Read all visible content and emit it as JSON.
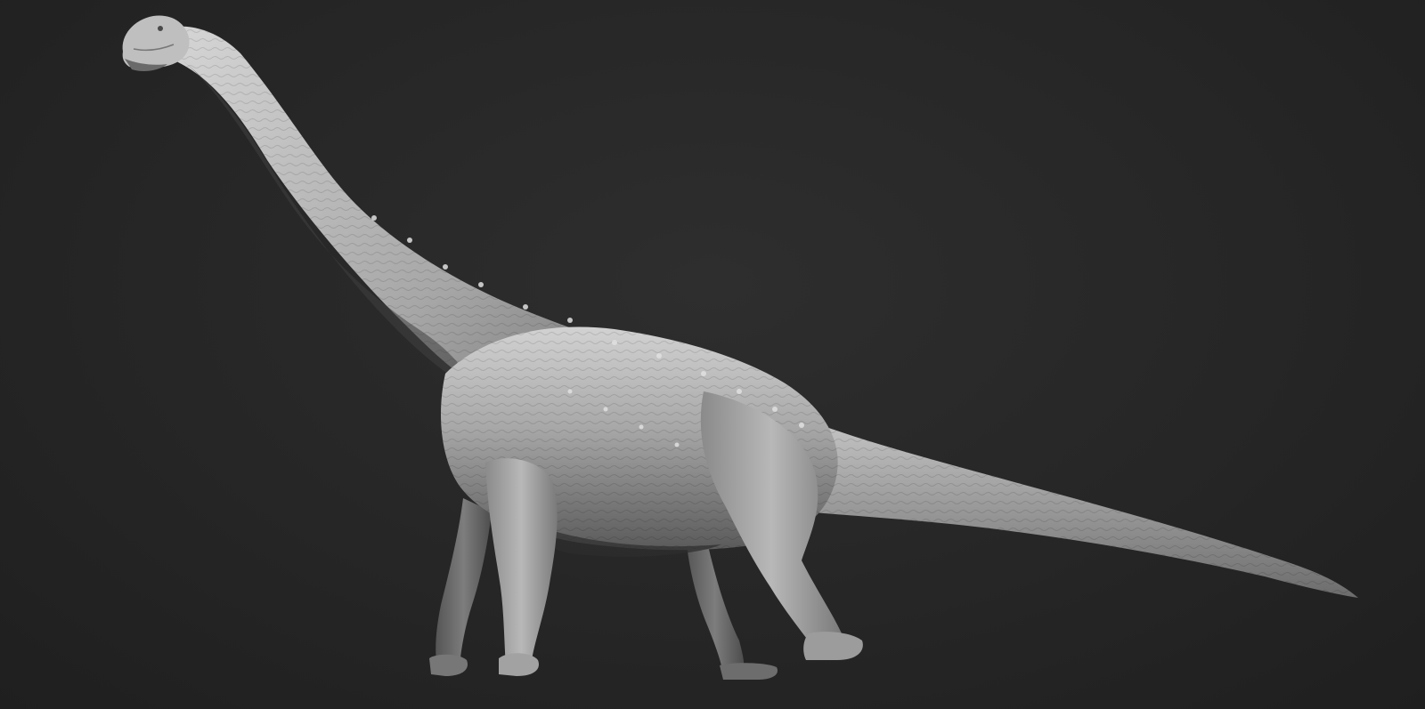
{
  "scene": {
    "subject": "sauropod-sculpt",
    "background_color": "#262626",
    "clay_color": "#9a9a9a",
    "clay_highlight": "#d6d6d6",
    "clay_shadow": "#4a4a4a"
  }
}
